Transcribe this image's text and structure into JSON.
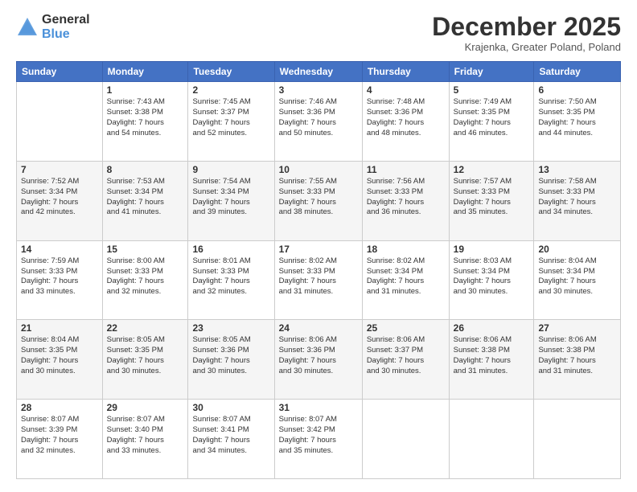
{
  "logo": {
    "general": "General",
    "blue": "Blue"
  },
  "title": "December 2025",
  "location": "Krajenka, Greater Poland, Poland",
  "days_header": [
    "Sunday",
    "Monday",
    "Tuesday",
    "Wednesday",
    "Thursday",
    "Friday",
    "Saturday"
  ],
  "weeks": [
    [
      {
        "day": "",
        "info": ""
      },
      {
        "day": "1",
        "info": "Sunrise: 7:43 AM\nSunset: 3:38 PM\nDaylight: 7 hours\nand 54 minutes."
      },
      {
        "day": "2",
        "info": "Sunrise: 7:45 AM\nSunset: 3:37 PM\nDaylight: 7 hours\nand 52 minutes."
      },
      {
        "day": "3",
        "info": "Sunrise: 7:46 AM\nSunset: 3:36 PM\nDaylight: 7 hours\nand 50 minutes."
      },
      {
        "day": "4",
        "info": "Sunrise: 7:48 AM\nSunset: 3:36 PM\nDaylight: 7 hours\nand 48 minutes."
      },
      {
        "day": "5",
        "info": "Sunrise: 7:49 AM\nSunset: 3:35 PM\nDaylight: 7 hours\nand 46 minutes."
      },
      {
        "day": "6",
        "info": "Sunrise: 7:50 AM\nSunset: 3:35 PM\nDaylight: 7 hours\nand 44 minutes."
      }
    ],
    [
      {
        "day": "7",
        "info": "Sunrise: 7:52 AM\nSunset: 3:34 PM\nDaylight: 7 hours\nand 42 minutes."
      },
      {
        "day": "8",
        "info": "Sunrise: 7:53 AM\nSunset: 3:34 PM\nDaylight: 7 hours\nand 41 minutes."
      },
      {
        "day": "9",
        "info": "Sunrise: 7:54 AM\nSunset: 3:34 PM\nDaylight: 7 hours\nand 39 minutes."
      },
      {
        "day": "10",
        "info": "Sunrise: 7:55 AM\nSunset: 3:33 PM\nDaylight: 7 hours\nand 38 minutes."
      },
      {
        "day": "11",
        "info": "Sunrise: 7:56 AM\nSunset: 3:33 PM\nDaylight: 7 hours\nand 36 minutes."
      },
      {
        "day": "12",
        "info": "Sunrise: 7:57 AM\nSunset: 3:33 PM\nDaylight: 7 hours\nand 35 minutes."
      },
      {
        "day": "13",
        "info": "Sunrise: 7:58 AM\nSunset: 3:33 PM\nDaylight: 7 hours\nand 34 minutes."
      }
    ],
    [
      {
        "day": "14",
        "info": "Sunrise: 7:59 AM\nSunset: 3:33 PM\nDaylight: 7 hours\nand 33 minutes."
      },
      {
        "day": "15",
        "info": "Sunrise: 8:00 AM\nSunset: 3:33 PM\nDaylight: 7 hours\nand 32 minutes."
      },
      {
        "day": "16",
        "info": "Sunrise: 8:01 AM\nSunset: 3:33 PM\nDaylight: 7 hours\nand 32 minutes."
      },
      {
        "day": "17",
        "info": "Sunrise: 8:02 AM\nSunset: 3:33 PM\nDaylight: 7 hours\nand 31 minutes."
      },
      {
        "day": "18",
        "info": "Sunrise: 8:02 AM\nSunset: 3:34 PM\nDaylight: 7 hours\nand 31 minutes."
      },
      {
        "day": "19",
        "info": "Sunrise: 8:03 AM\nSunset: 3:34 PM\nDaylight: 7 hours\nand 30 minutes."
      },
      {
        "day": "20",
        "info": "Sunrise: 8:04 AM\nSunset: 3:34 PM\nDaylight: 7 hours\nand 30 minutes."
      }
    ],
    [
      {
        "day": "21",
        "info": "Sunrise: 8:04 AM\nSunset: 3:35 PM\nDaylight: 7 hours\nand 30 minutes."
      },
      {
        "day": "22",
        "info": "Sunrise: 8:05 AM\nSunset: 3:35 PM\nDaylight: 7 hours\nand 30 minutes."
      },
      {
        "day": "23",
        "info": "Sunrise: 8:05 AM\nSunset: 3:36 PM\nDaylight: 7 hours\nand 30 minutes."
      },
      {
        "day": "24",
        "info": "Sunrise: 8:06 AM\nSunset: 3:36 PM\nDaylight: 7 hours\nand 30 minutes."
      },
      {
        "day": "25",
        "info": "Sunrise: 8:06 AM\nSunset: 3:37 PM\nDaylight: 7 hours\nand 30 minutes."
      },
      {
        "day": "26",
        "info": "Sunrise: 8:06 AM\nSunset: 3:38 PM\nDaylight: 7 hours\nand 31 minutes."
      },
      {
        "day": "27",
        "info": "Sunrise: 8:06 AM\nSunset: 3:38 PM\nDaylight: 7 hours\nand 31 minutes."
      }
    ],
    [
      {
        "day": "28",
        "info": "Sunrise: 8:07 AM\nSunset: 3:39 PM\nDaylight: 7 hours\nand 32 minutes."
      },
      {
        "day": "29",
        "info": "Sunrise: 8:07 AM\nSunset: 3:40 PM\nDaylight: 7 hours\nand 33 minutes."
      },
      {
        "day": "30",
        "info": "Sunrise: 8:07 AM\nSunset: 3:41 PM\nDaylight: 7 hours\nand 34 minutes."
      },
      {
        "day": "31",
        "info": "Sunrise: 8:07 AM\nSunset: 3:42 PM\nDaylight: 7 hours\nand 35 minutes."
      },
      {
        "day": "",
        "info": ""
      },
      {
        "day": "",
        "info": ""
      },
      {
        "day": "",
        "info": ""
      }
    ]
  ]
}
